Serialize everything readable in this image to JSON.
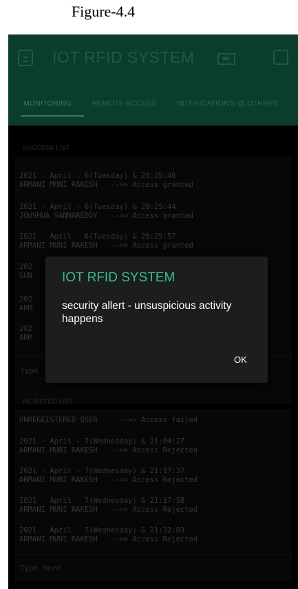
{
  "figure_caption": "Figure-4.4",
  "app": {
    "title": "IOT RFID SYSTEM"
  },
  "tabs": [
    {
      "label": "MONITORING"
    },
    {
      "label": "REMOTE ACCESS"
    },
    {
      "label": "NOTIFICATION'S @ OTHERS"
    }
  ],
  "success_list": {
    "label": "SUCCESS LIST",
    "lines": [
      "2021 - April - 6(Tuesday) & 20:25:46",
      "ARMANI MUNI RAKESH   -->> Access granted",
      "2021 - April - 6(Tuesday) & 20:25:44",
      "JOUSHUA SANNAREDDY   -->> Access granted",
      "2021 - April - 6(Tuesday) & 20:25:57",
      "ARMANI MUNI RAKESH   -->> Access granted",
      "202",
      "GUN",
      "202",
      "ARM",
      "202",
      "ARM"
    ],
    "input_placeholder": "Type"
  },
  "rejected_list": {
    "label": "REJECTED LIST",
    "lines": [
      "UNREGEISTERED USER     -->> Access failed",
      "2021 - April - 7(Wednesday) & 21:04:27",
      "ARMANI MUNI RAKESH   -->> Access Rejected",
      "2021 - April - 7(Wednesday) & 21:17:37",
      "ARMANI MUNI RAKESH   -->> Access Rejected",
      "2021 - April - 7(Wednesday) & 21:17:58",
      "ARMANI MUNI RAKESH   -->> Access Rejected",
      "2021 - April - 7(Wednesday) & 21:32:03",
      "ARMANI MUNI RAKESH   -->> Access Rejected"
    ],
    "input_placeholder": "Type here"
  },
  "dialog": {
    "title": "IOT RFID SYSTEM",
    "message": "security allert - unsuspicious activity happens",
    "ok_label": "OK"
  },
  "icons": {
    "left": "exit-icon",
    "battery": "battery-icon",
    "right": "square-icon"
  },
  "colors": {
    "header_bg": "#0b3d2c",
    "dimmed_text": "#1f5a44",
    "dialog_title": "#36c08a"
  }
}
